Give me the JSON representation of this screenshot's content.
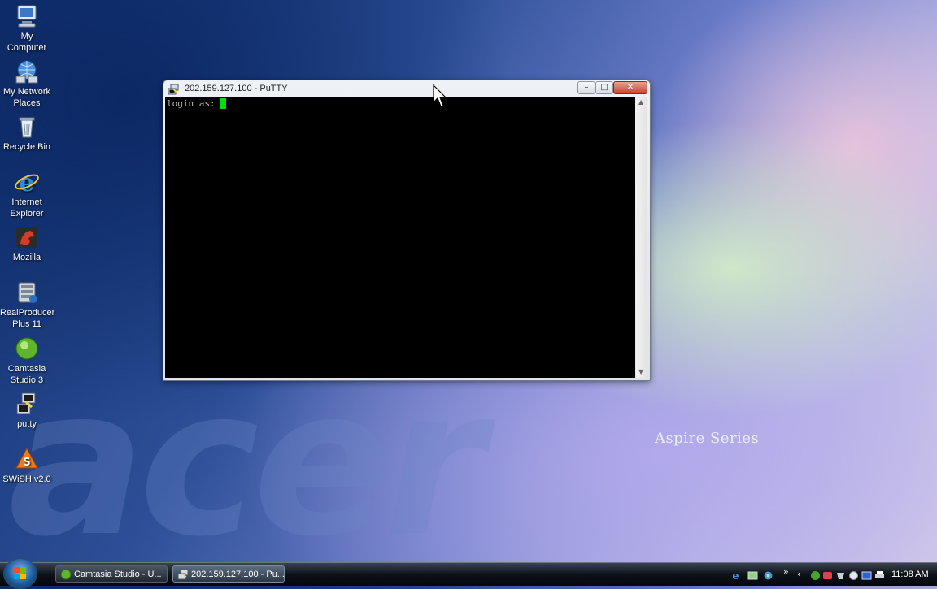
{
  "desktop": {
    "brand_text": "acer",
    "series_text": "Aspire Series",
    "icons": [
      {
        "label": "My Computer",
        "icon": "my-computer-icon"
      },
      {
        "label": "My Network Places",
        "icon": "network-places-icon"
      },
      {
        "label": "Recycle Bin",
        "icon": "recycle-bin-icon"
      },
      {
        "label": "Internet Explorer",
        "icon": "internet-explorer-icon"
      },
      {
        "label": "Mozilla",
        "icon": "mozilla-icon"
      },
      {
        "label": "RealProducer Plus 11",
        "icon": "realproducer-icon"
      },
      {
        "label": "Camtasia Studio 3",
        "icon": "camtasia-icon"
      },
      {
        "label": "putty",
        "icon": "putty-icon"
      },
      {
        "label": "SWiSH v2.0",
        "icon": "swish-icon"
      }
    ]
  },
  "putty_window": {
    "title": "202.159.127.100 - PuTTY",
    "prompt": "login as: ",
    "cursor_color": "#00e000",
    "buttons": {
      "minimize": "minimize-icon",
      "maximize": "maximize-icon",
      "close": "close-icon"
    }
  },
  "taskbar": {
    "start_icon": "windows-start-icon",
    "tasks": [
      {
        "label": "Camtasia Studio - U...",
        "icon": "camtasia-icon",
        "active": false
      },
      {
        "label": "202.159.127.100 - Pu...",
        "icon": "putty-icon",
        "active": true
      }
    ],
    "quick_launch": [
      "internet-explorer-icon",
      "show-desktop-icon",
      "switch-windows-icon"
    ],
    "overflow_glyph": "»",
    "tray": [
      "chevron-left-icon",
      "camtasia-tray-icon",
      "security-icon",
      "network-icon",
      "tray-app-icon",
      "volume-icon",
      "display-icon",
      "printer-icon"
    ],
    "clock": "11:08 AM"
  },
  "colors": {
    "terminal_bg": "#000000",
    "terminal_fg": "#bbbbbb",
    "cursor": "#00e000",
    "taskbar": "#0d1218"
  }
}
